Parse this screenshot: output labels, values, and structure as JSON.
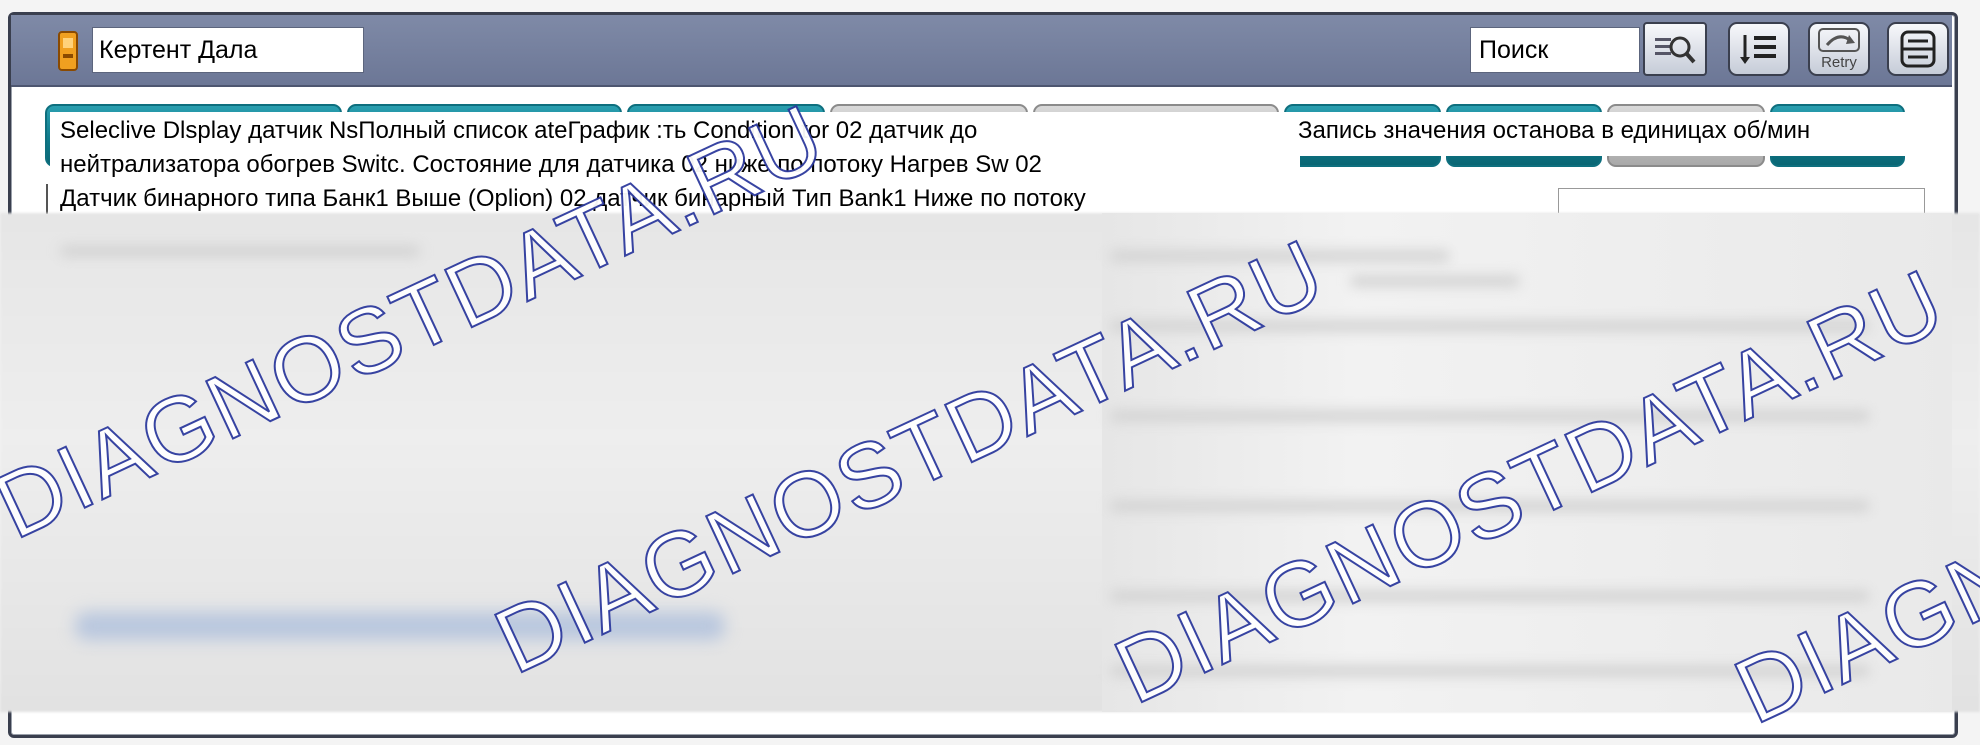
{
  "header": {
    "device_name": "Кертент Дала",
    "search_placeholder": "Поиск",
    "icons": [
      "device-icon",
      "zoom-search-icon",
      "list-icon",
      "retry-icon",
      "menu-icon"
    ],
    "retry_label": "Retry"
  },
  "tabs_text": {
    "left": "Seleclive Dlsplay датчик NsПолный список ateГрафик :ть Condition tor 02 датчик до\nнейтрализатора обогрев Switc. Состояние для датчика 02 ниже по потоку Нагрев Sw 02",
    "right": "Запись значения останова в единицах об/мин"
  },
  "info_line": "Датчик бинарного типа Банк1 Выше (Oplion) 02 датчик бинарный Тип Bank1 Ниже по потоку",
  "watermark_text": "DIAGNOSTDATA.RU",
  "colors": {
    "topbar": "#7682a0",
    "tab_teal": "#0e7888",
    "tab_grey": "#b0b0b0",
    "watermark": "#2e3b9e"
  }
}
